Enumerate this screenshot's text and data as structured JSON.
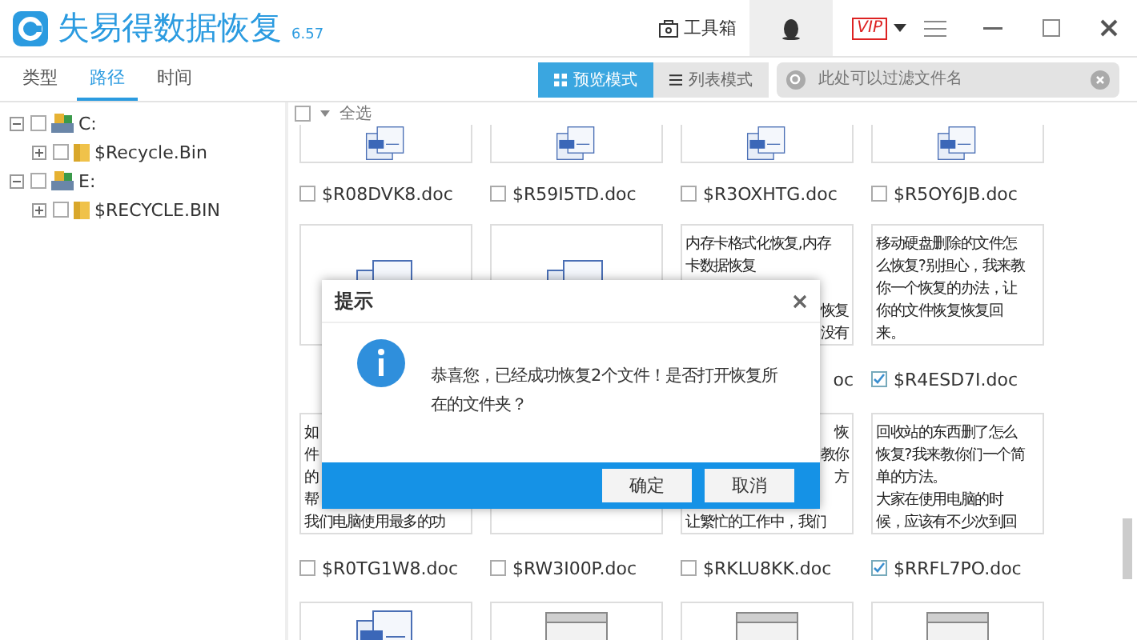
{
  "window": {
    "title": "失易得数据恢复",
    "version": "6.57",
    "toolbox": "工具箱",
    "vip": "VIP"
  },
  "tabs": [
    {
      "label": "类型",
      "selected": false
    },
    {
      "label": "路径",
      "selected": true
    },
    {
      "label": "时间",
      "selected": false
    }
  ],
  "view_modes": [
    {
      "label": "预览模式",
      "kind": "grid",
      "selected": true
    },
    {
      "label": "列表模式",
      "kind": "list",
      "selected": false
    }
  ],
  "search": {
    "placeholder": "此处可以过滤文件名"
  },
  "tree": [
    {
      "label": "C:",
      "kind": "drive",
      "checked": false,
      "expanded": true,
      "children": [
        {
          "label": "$Recycle.Bin",
          "kind": "folder",
          "checked": false,
          "expanded": false
        }
      ]
    },
    {
      "label": "E:",
      "kind": "drive",
      "checked": false,
      "expanded": true,
      "children": [
        {
          "label": "$RECYCLE.BIN",
          "kind": "folder",
          "checked": false,
          "expanded": false
        }
      ]
    }
  ],
  "select_all": {
    "label": "全选",
    "checked": false
  },
  "rows": [
    {
      "kind": "top",
      "files": [
        {
          "name": "$R08DVK8.doc",
          "checked": false,
          "kind": "doc"
        },
        {
          "name": "$R59I5TD.doc",
          "checked": false,
          "kind": "doc"
        },
        {
          "name": "$R3OXHTG.doc",
          "checked": false,
          "kind": "doc"
        },
        {
          "name": "$R5OY6JB.doc",
          "checked": false,
          "kind": "doc"
        }
      ]
    },
    {
      "kind": "full",
      "files": [
        {
          "kind": "doc"
        },
        {
          "kind": "doc"
        },
        {
          "name": "oc",
          "covered": true,
          "kind": "text",
          "lines": [
            {
              "text": "内存卡格式化恢复,内存",
              "kind": "full"
            },
            {
              "text": "卡数据恢复",
              "kind": "full"
            },
            {
              "text": "恢复",
              "kind": "tail"
            },
            {
              "text": "没有",
              "kind": "tail"
            }
          ]
        },
        {
          "name": "$R4ESD7I.doc",
          "checked": true,
          "kind": "text",
          "lines": [
            {
              "text": "移动硬盘删除的文件怎",
              "kind": "full"
            },
            {
              "text": "么恢复?别担心，我来教",
              "kind": "full"
            },
            {
              "text": "你一个恢复的办法，让",
              "kind": "full"
            },
            {
              "text": "你的文件恢复恢复回",
              "kind": "full"
            },
            {
              "text": "来。",
              "kind": "full"
            }
          ]
        }
      ]
    },
    {
      "kind": "full",
      "files": [
        {
          "name": "$R0TG1W8.doc",
          "checked": false,
          "kind": "text",
          "lines": [
            {
              "text": "如",
              "kind": "head"
            },
            {
              "text": "件",
              "kind": "head"
            },
            {
              "text": "的",
              "kind": "head"
            },
            {
              "text": "帮",
              "kind": "head"
            },
            {
              "text": "我们电脑使用最多的功",
              "kind": "full"
            }
          ]
        },
        {
          "name": "$RW3I00P.doc",
          "checked": false,
          "kind": "blank"
        },
        {
          "name": "$RKLU8KK.doc",
          "checked": false,
          "kind": "text",
          "lines": [
            {
              "text": "恢",
              "kind": "tail"
            },
            {
              "text": "教你",
              "kind": "tail"
            },
            {
              "text": "方",
              "kind": "tail"
            },
            {
              "text": "让繁忙的工作中，我们",
              "kind": "full"
            }
          ]
        },
        {
          "name": "$RRFL7PO.doc",
          "checked": true,
          "kind": "text",
          "lines": [
            {
              "text": "回收站的东西删了怎么",
              "kind": "full"
            },
            {
              "text": "恢复?我来教你们一个简",
              "kind": "full"
            },
            {
              "text": "单的方法。",
              "kind": "full"
            },
            {
              "text": "大家在使用电脑的时",
              "kind": "full"
            },
            {
              "text": "候，应该有不少次到回",
              "kind": "full"
            }
          ]
        }
      ]
    },
    {
      "kind": "bottom",
      "files": [
        {
          "kind": "doc"
        },
        {
          "kind": "window"
        },
        {
          "kind": "window"
        },
        {
          "kind": "window"
        }
      ]
    }
  ],
  "dialog": {
    "title": "提示",
    "message": "恭喜您，已经成功恢复2个文件！是否打开恢复所在的文件夹？",
    "buttons": [
      "确定",
      "取消"
    ]
  }
}
